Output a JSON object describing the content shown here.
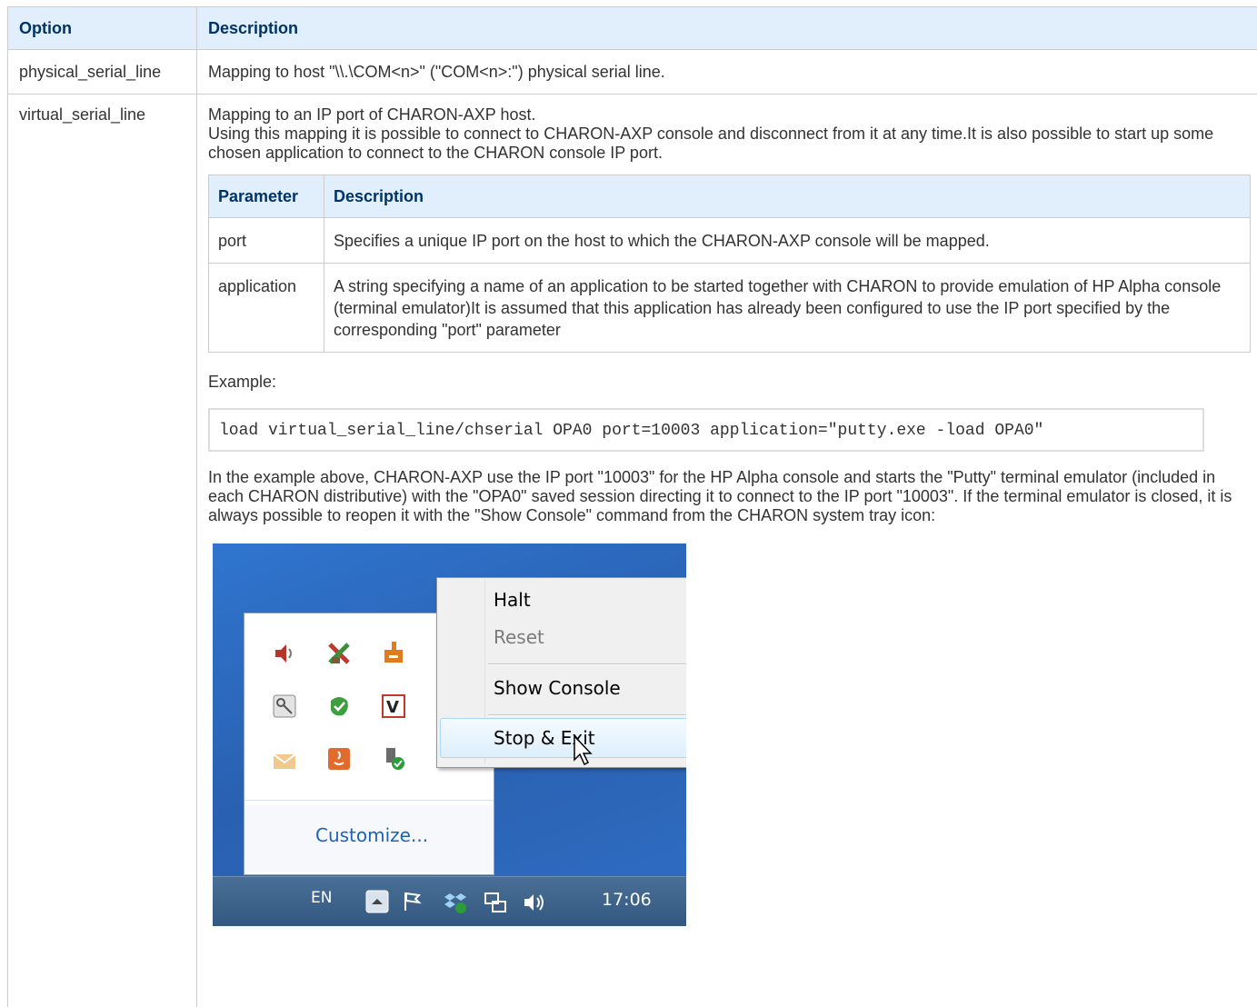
{
  "table": {
    "headers": [
      "Option",
      "Description"
    ],
    "row1": {
      "option": "physical_serial_line",
      "description": "Mapping to host \"\\\\.\\COM<n>\" (\"COM<n>:\") physical serial line."
    },
    "row2": {
      "option": "virtual_serial_line",
      "intro_line1": "Mapping to an IP port of CHARON-AXP host.",
      "intro_line2": "Using this mapping it is possible to connect to CHARON-AXP console and disconnect from it at any time.It is also possible to start up some chosen application to connect to the CHARON console IP port.",
      "params": {
        "headers": [
          "Parameter",
          "Description"
        ],
        "rows": [
          {
            "name": "port",
            "description": "Specifies a unique IP port on the host to which the CHARON-AXP console will be mapped."
          },
          {
            "name": "application",
            "description": "A string specifying a name of an application to be started together with CHARON to provide emulation of HP Alpha console (terminal emulator)It is assumed that this application has already been configured to use the IP port specified by the corresponding \"port\" parameter"
          }
        ]
      },
      "example_label": "Example:",
      "example_code": "load virtual_serial_line/chserial OPA0 port=10003 application=\"putty.exe -load OPA0\"",
      "explanation": "In the example above, CHARON-AXP use the IP port \"10003\" for the HP Alpha console and starts the \"Putty\" terminal emulator (included in each CHARON distributive) with the \"OPA0\" saved session directing it to connect to the IP port \"10003\". If the terminal emulator is closed, it is always possible to reopen it with the \"Show Console\" command from the CHARON system tray icon:"
    }
  },
  "screenshot": {
    "context_menu": {
      "items": [
        "Halt",
        "Reset",
        "Show Console",
        "Stop & Exit"
      ],
      "disabled": [
        "Reset"
      ],
      "highlighted": "Stop & Exit"
    },
    "tray_customize": "Customize...",
    "taskbar": {
      "language": "EN",
      "clock": "17:06"
    },
    "tray_icons": [
      "speaker-icon",
      "network-disconnected-icon",
      "charon-icon",
      "key-icon",
      "leaf-icon",
      "vmware-icon",
      "mail-icon",
      "java-icon",
      "usb-device-icon"
    ],
    "colors": {
      "desktop": "#2e6bc0",
      "menu_highlight": "#deeffc",
      "customize_link": "#1e62b8"
    }
  }
}
